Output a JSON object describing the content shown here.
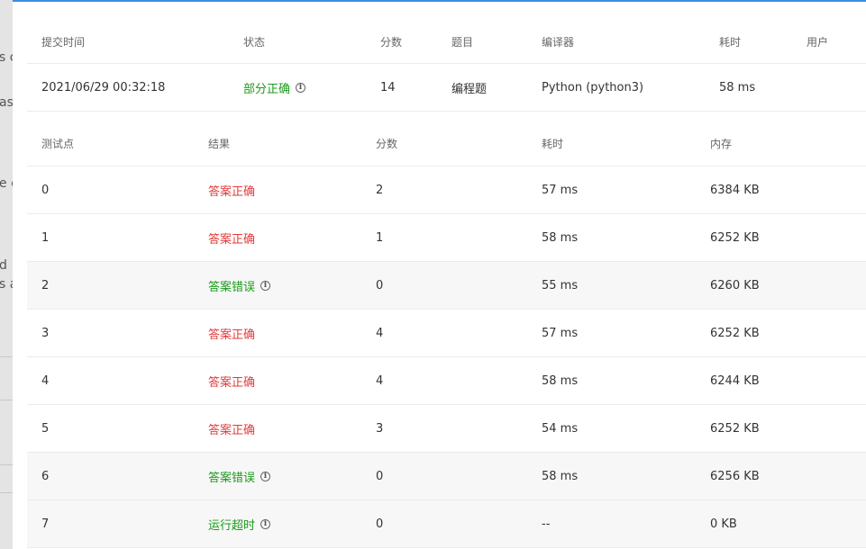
{
  "background": {
    "fragments": [
      "s c",
      "as",
      "e c",
      "d",
      "s a"
    ]
  },
  "submission": {
    "headers": {
      "time": "提交时间",
      "status": "状态",
      "score": "分数",
      "problem": "题目",
      "compiler": "编译器",
      "duration": "耗时",
      "user": "用户"
    },
    "row": {
      "time": "2021/06/29 00:32:18",
      "status": "部分正确",
      "score": "14",
      "problem": "编程题",
      "compiler": "Python (python3)",
      "duration": "58 ms",
      "user": ""
    }
  },
  "tests": {
    "headers": {
      "point": "测试点",
      "result": "结果",
      "score": "分数",
      "duration": "耗时",
      "memory": "内存"
    },
    "rows": [
      {
        "point": "0",
        "result": "答案正确",
        "status": "ok",
        "score": "2",
        "duration": "57 ms",
        "memory": "6384 KB"
      },
      {
        "point": "1",
        "result": "答案正确",
        "status": "ok",
        "score": "1",
        "duration": "58 ms",
        "memory": "6252 KB"
      },
      {
        "point": "2",
        "result": "答案错误",
        "status": "warn",
        "score": "0",
        "duration": "55 ms",
        "memory": "6260 KB"
      },
      {
        "point": "3",
        "result": "答案正确",
        "status": "ok",
        "score": "4",
        "duration": "57 ms",
        "memory": "6252 KB"
      },
      {
        "point": "4",
        "result": "答案正确",
        "status": "ok",
        "score": "4",
        "duration": "58 ms",
        "memory": "6244 KB"
      },
      {
        "point": "5",
        "result": "答案正确",
        "status": "ok",
        "score": "3",
        "duration": "54 ms",
        "memory": "6252 KB"
      },
      {
        "point": "6",
        "result": "答案错误",
        "status": "warn",
        "score": "0",
        "duration": "58 ms",
        "memory": "6256 KB"
      },
      {
        "point": "7",
        "result": "运行超时",
        "status": "warn",
        "score": "0",
        "duration": "--",
        "memory": "0 KB"
      }
    ]
  },
  "icons": {
    "info": "info-icon",
    "info_glyph": "i"
  },
  "colors": {
    "accent": "#3b8de6",
    "ok": "#e33b3b",
    "warn": "#1a9b1a"
  }
}
